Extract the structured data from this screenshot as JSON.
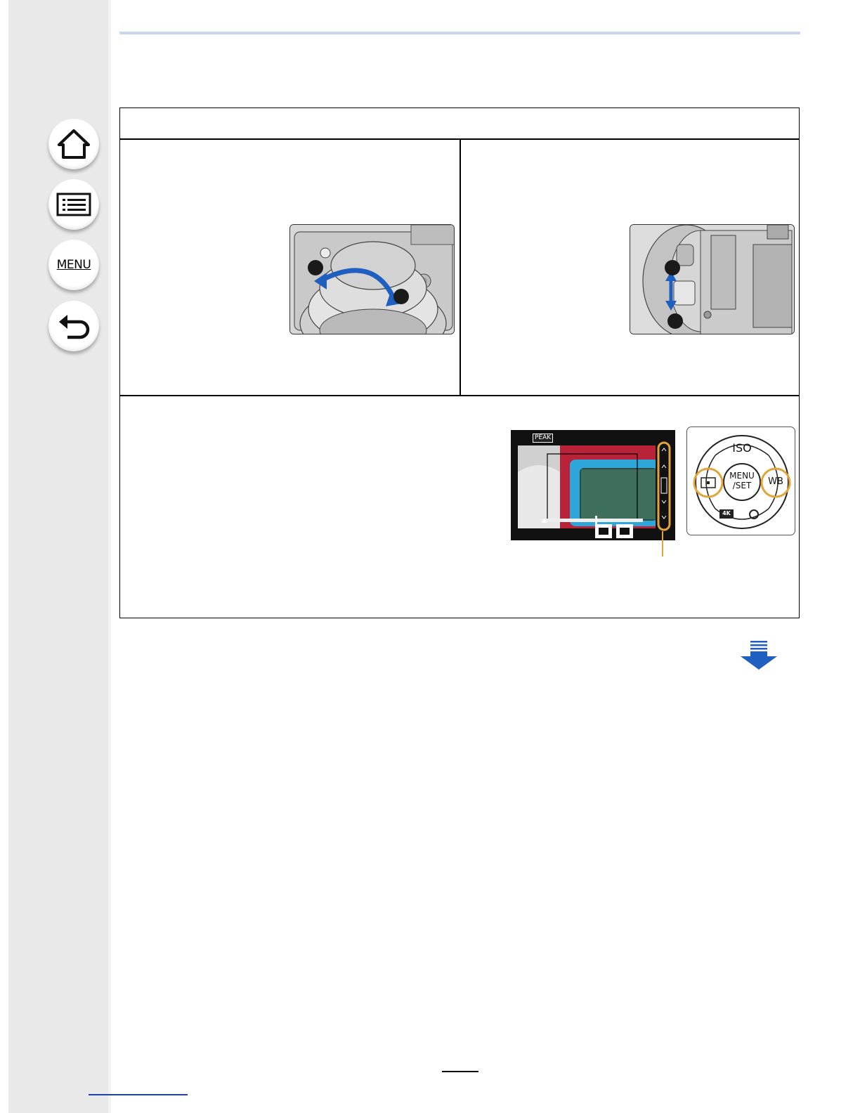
{
  "sidebar": {
    "buttons": [
      {
        "id": "home",
        "icon": "home-icon"
      },
      {
        "id": "contents",
        "icon": "list-icon"
      },
      {
        "id": "menu",
        "icon": "menu-icon",
        "label": "MENU"
      },
      {
        "id": "back",
        "icon": "back-arrow-icon"
      }
    ]
  },
  "colors": {
    "accent_rule": "#c9d6f2",
    "arrow_blue": "#1f5fbf",
    "highlight_orange": "#e3a43a",
    "sidebar_bg": "#e9e9e9"
  },
  "lcd_screen": {
    "peak_label": "PEAK"
  },
  "control_dial": {
    "top_label": "ISO",
    "center_label_line1": "MENU",
    "center_label_line2": "/SET",
    "right_label": "WB",
    "bottom_label": "4K"
  },
  "navigation": {
    "next_page_icon": "next-page-arrow-icon"
  }
}
